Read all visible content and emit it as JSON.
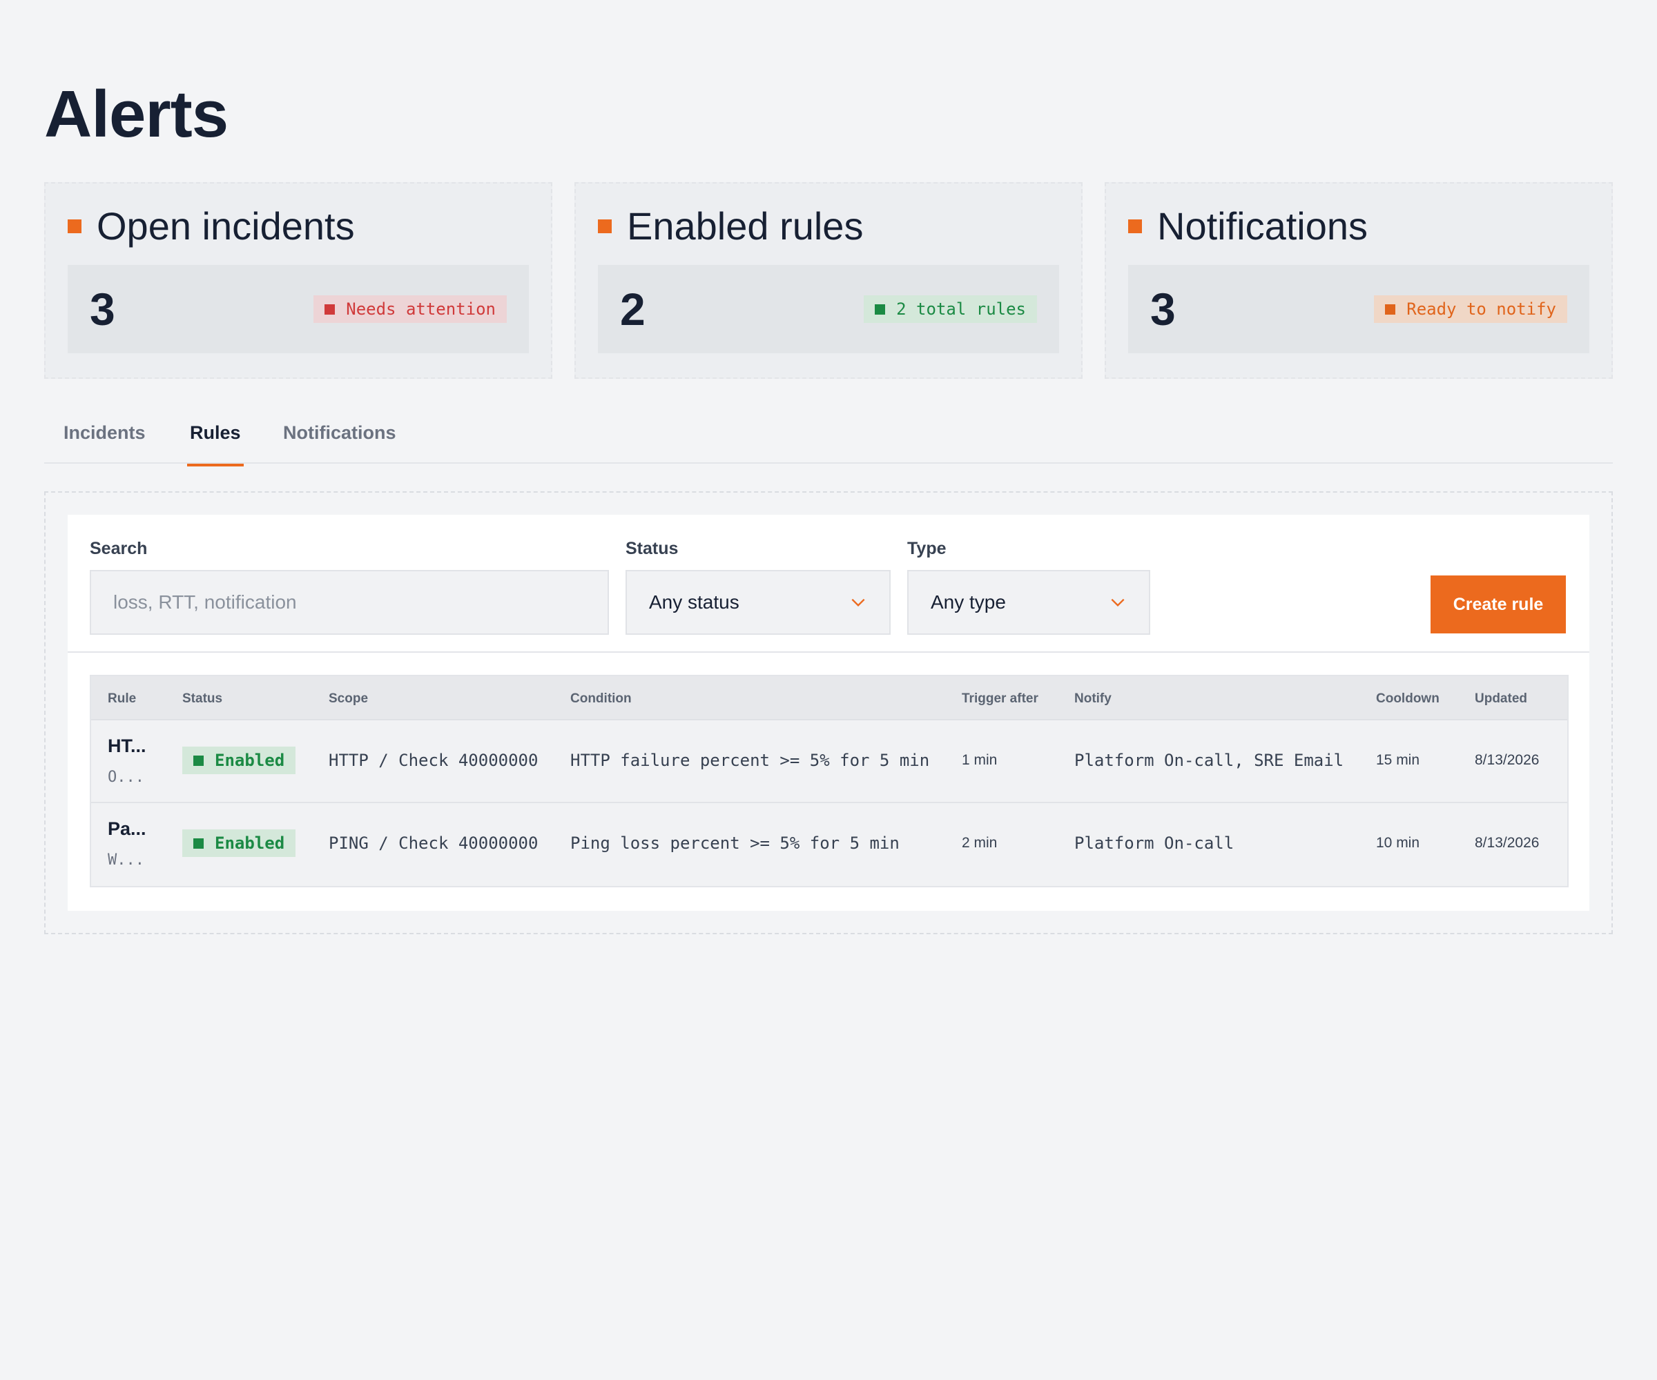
{
  "header": {
    "title": "Alerts"
  },
  "summary_cards": [
    {
      "title": "Open incidents",
      "value": "3",
      "badge": "Needs attention",
      "badge_color": "#d03a3a"
    },
    {
      "title": "Enabled rules",
      "value": "2",
      "badge": "2 total rules",
      "badge_color": "#1b8a44"
    },
    {
      "title": "Notifications",
      "value": "3",
      "badge": "Ready to notify",
      "badge_color": "#e0641b"
    }
  ],
  "tabs": [
    {
      "label": "Incidents",
      "active": false
    },
    {
      "label": "Rules",
      "active": true
    },
    {
      "label": "Notifications",
      "active": false
    }
  ],
  "filters": {
    "search": {
      "label": "Search",
      "placeholder": "loss, RTT, notification",
      "value": ""
    },
    "status": {
      "label": "Status",
      "selected": "Any status"
    },
    "type": {
      "label": "Type",
      "selected": "Any type"
    },
    "create_button": "Create rule"
  },
  "table": {
    "columns": [
      "Rule",
      "Status",
      "Scope",
      "Condition",
      "Trigger after",
      "Notify",
      "Cooldown",
      "Updated"
    ],
    "rows": [
      {
        "rule": "HT...",
        "rule_sub": "O...",
        "status": "Enabled",
        "scope": "HTTP / Check 40000000",
        "condition": "HTTP failure percent >= 5% for 5 min",
        "trigger_after": "1 min",
        "notify": "Platform On-call, SRE Email",
        "cooldown": "15 min",
        "updated": "8/13/2026"
      },
      {
        "rule": "Pa...",
        "rule_sub": "W...",
        "status": "Enabled",
        "scope": "PING / Check 40000000",
        "condition": "Ping loss percent >= 5% for 5 min",
        "trigger_after": "2 min",
        "notify": "Platform On-call",
        "cooldown": "10 min",
        "updated": "8/13/2026"
      }
    ]
  },
  "colors": {
    "accent": "#ec6a1e",
    "background": "#f3f4f6",
    "text": "#172033",
    "enabled": "#1b8a44"
  },
  "icons": {
    "card_marker": "square-icon",
    "select_arrow": "chevron-down-icon"
  }
}
